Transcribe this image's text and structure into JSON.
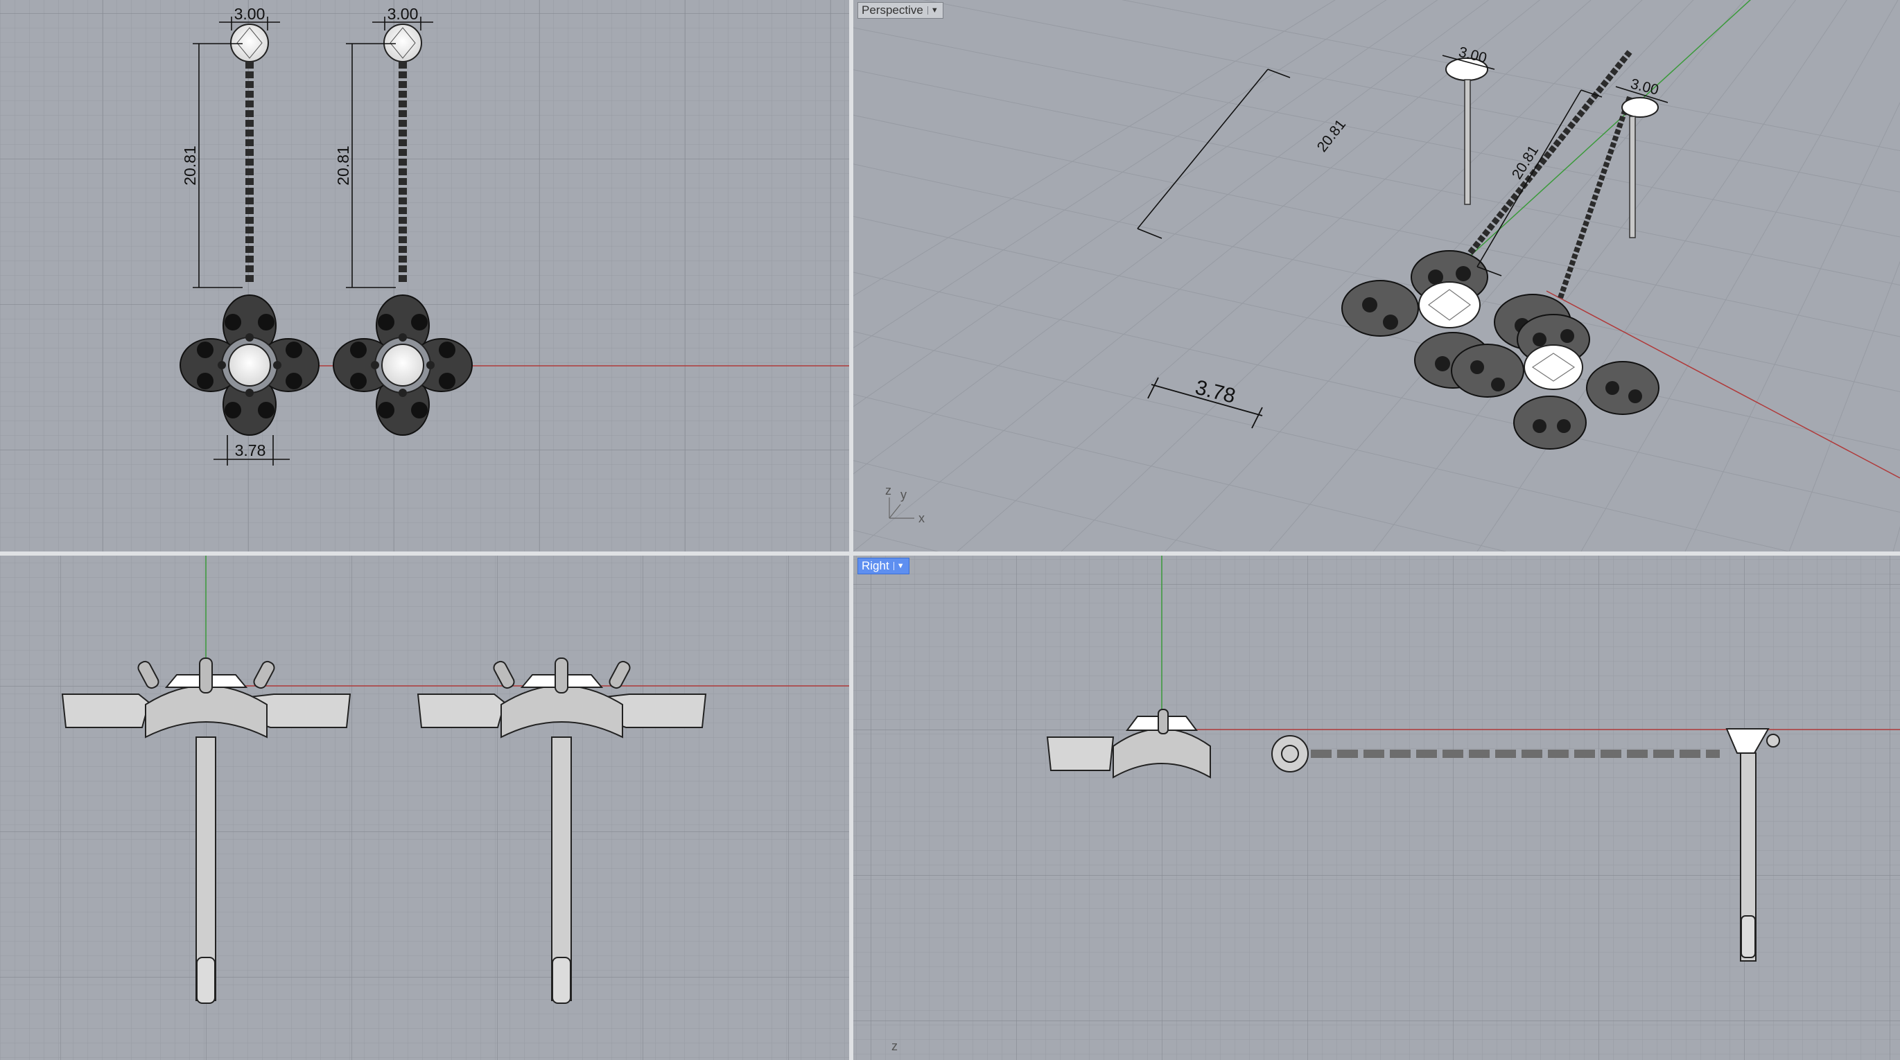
{
  "viewports": {
    "top": {
      "label": ""
    },
    "perspective": {
      "label": "Perspective"
    },
    "front": {
      "label": ""
    },
    "right": {
      "label": "Right"
    }
  },
  "dimensions": {
    "stud_width": "3.00",
    "drop_length": "20.81",
    "flower_offset": "3.78"
  },
  "axis_labels": {
    "x": "x",
    "y": "y",
    "z": "z"
  },
  "colors": {
    "viewport_bg": "#a5a9b1",
    "grid_minor": "#979ba3",
    "grid_major": "#8b8f97",
    "x_axis": "#b03a3a",
    "y_axis": "#3a9a3a",
    "active_label": "#5e8ff0"
  }
}
